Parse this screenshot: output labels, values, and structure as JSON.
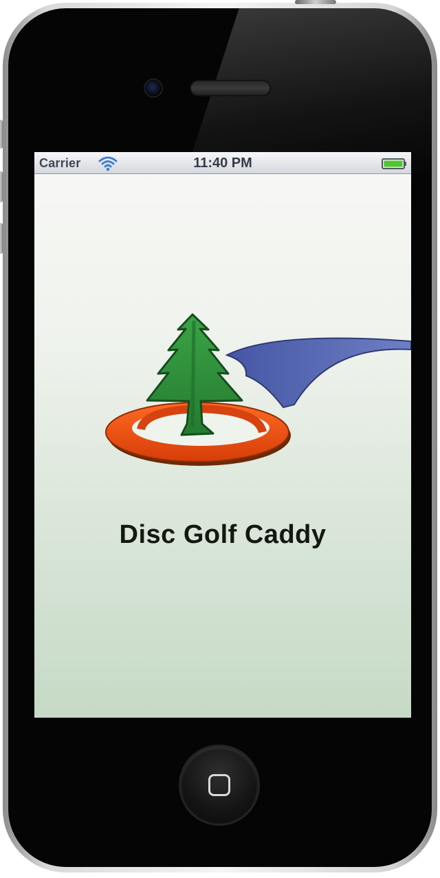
{
  "status_bar": {
    "carrier": "Carrier",
    "time": "11:40 PM",
    "wifi_icon": "wifi-icon",
    "battery_icon": "battery-icon",
    "battery_color": "#4fc732"
  },
  "splash": {
    "title": "Disc Golf Caddy",
    "logo_icon": "disc-golf-tree-logo-icon",
    "colors": {
      "tree": "#2f8f3a",
      "basket_ring": "#e24b12",
      "swoosh": "#4f5fa8"
    }
  },
  "device": {
    "home_button_icon": "home-button-icon"
  }
}
